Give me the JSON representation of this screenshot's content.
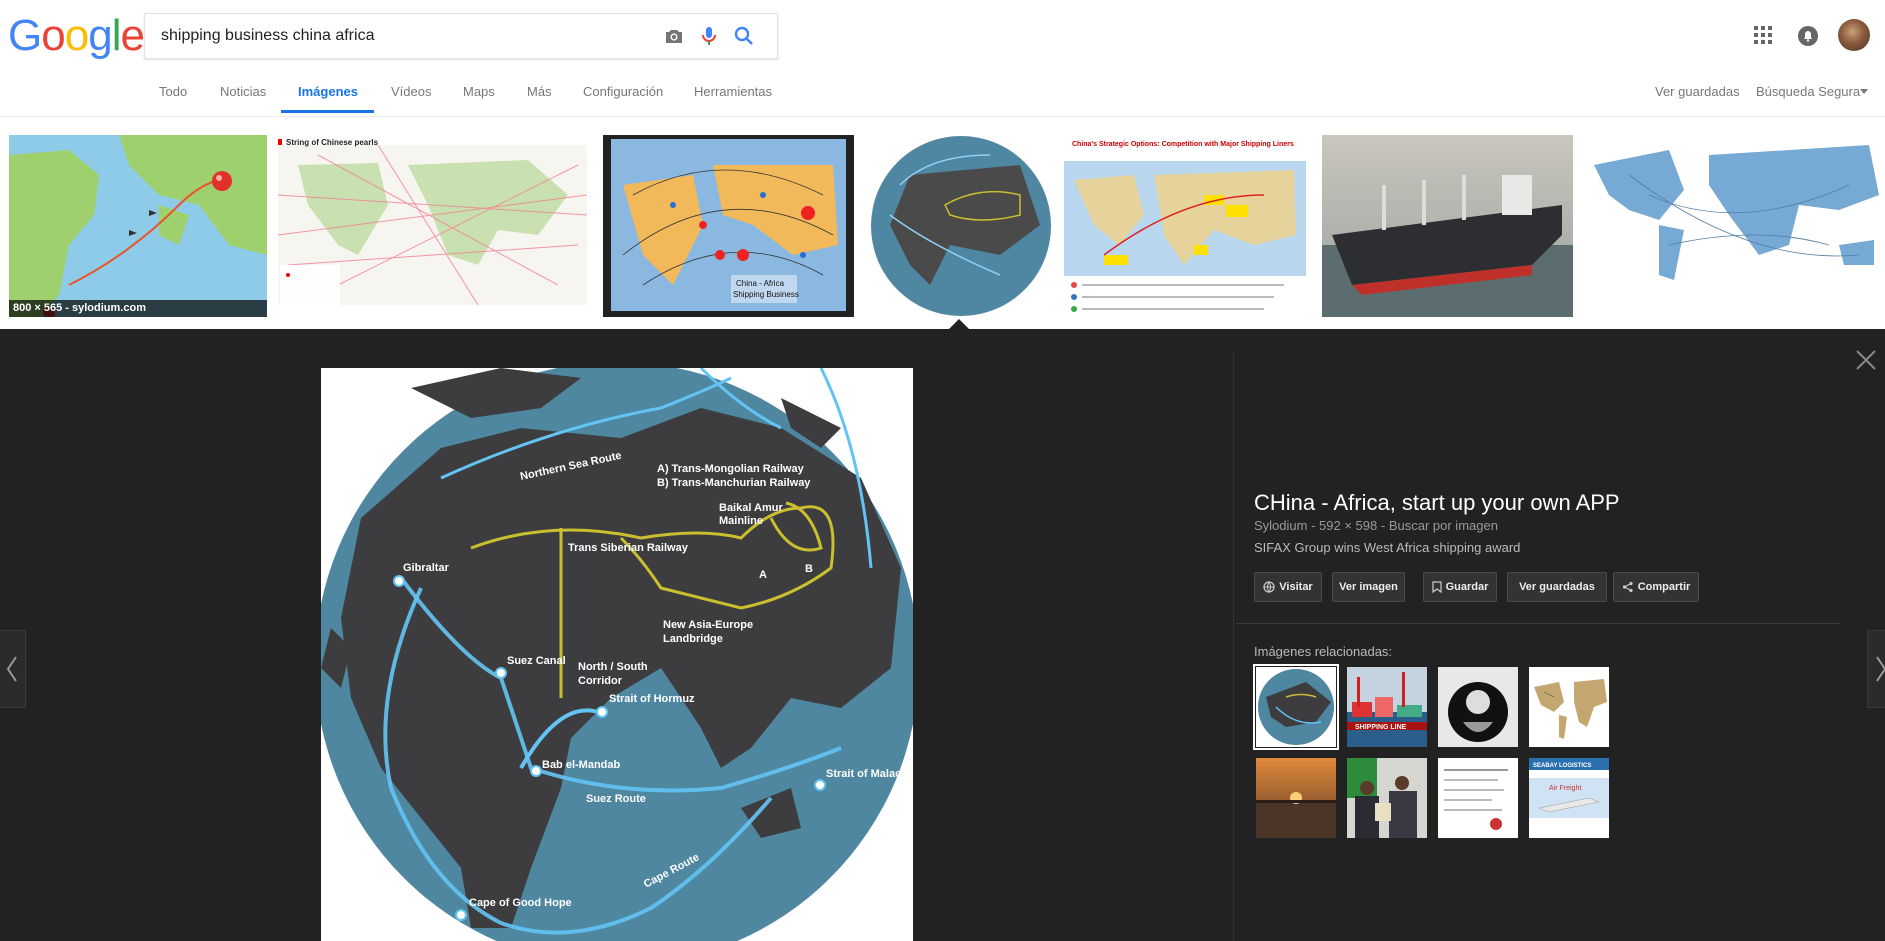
{
  "logo": {
    "text": "Google",
    "letters": [
      "G",
      "o",
      "o",
      "g",
      "l",
      "e"
    ],
    "colors": [
      "#4285f4",
      "#ea4335",
      "#fbbc05",
      "#4285f4",
      "#34a853",
      "#ea4335"
    ]
  },
  "search": {
    "value": "shipping business china africa",
    "icons": [
      "camera-icon",
      "microphone-icon",
      "search-icon"
    ]
  },
  "header_icons": [
    "apps-grid-icon",
    "notifications-bell-icon",
    "account-avatar"
  ],
  "tabs": [
    {
      "label": "Todo"
    },
    {
      "label": "Noticias"
    },
    {
      "label": "Imágenes",
      "active": true
    },
    {
      "label": "Vídeos"
    },
    {
      "label": "Maps"
    },
    {
      "label": "Más"
    },
    {
      "label": "Configuración"
    },
    {
      "label": "Herramientas"
    }
  ],
  "right_links": {
    "saved": "Ver guardadas",
    "safe_search": "Búsqueda Segura"
  },
  "strip": {
    "caption": "800 × 565 - sylodium.com",
    "thumbs": [
      {
        "name": "africa-asia-shipping-map"
      },
      {
        "name": "string-of-chinese-pearls-map",
        "title": "String of Chinese pearls"
      },
      {
        "name": "china-africa-shipping-business-map",
        "label": "China - Africa\nShipping Business"
      },
      {
        "name": "globe-routes-map"
      },
      {
        "name": "china-strategic-options-map",
        "title": "China's Strategic Options: Competition with Major Shipping Liners"
      },
      {
        "name": "cargo-ship-photo"
      },
      {
        "name": "world-routes-blue-map"
      }
    ]
  },
  "viewer": {
    "title": "CHina - Africa, start up your own APP",
    "source": "Sylodium",
    "size": "592 × 598",
    "search_by_image": "Buscar por imagen",
    "description": "SIFAX Group wins West Africa shipping award",
    "buttons": {
      "visit": "Visitar",
      "view_image": "Ver imagen",
      "save": "Guardar",
      "view_saved": "Ver guardadas",
      "share": "Compartir"
    },
    "related_label": "Imágenes relacionadas:",
    "map_labels": {
      "northern_sea": "Northern Sea Route",
      "trans_mongolian": "A) Trans-Mongolian Railway",
      "trans_manchurian": "B) Trans-Manchurian Railway",
      "baikal": "Baikal Amur",
      "baikal2": "Mainline",
      "trans_siberian": "Trans Siberian Railway",
      "gibraltar": "Gibraltar",
      "suez_canal": "Suez Canal",
      "north_south": "North / South",
      "corridor": "Corridor",
      "new_asia": "New Asia-Europe",
      "landbridge": "Landbridge",
      "hormuz": "Strait of Hormuz",
      "bab": "Bab el-Mandab",
      "suez_route": "Suez Route",
      "malacca": "Strait of Malacca",
      "cape_route": "Cape Route",
      "good_hope": "Cape of Good Hope",
      "a": "A",
      "b": "B"
    }
  },
  "related": {
    "shipping_line_text": "SHIPPING LINE",
    "air_freight_text": "Air Freight",
    "logistics_text": "SEABAY LOGISTICS"
  }
}
